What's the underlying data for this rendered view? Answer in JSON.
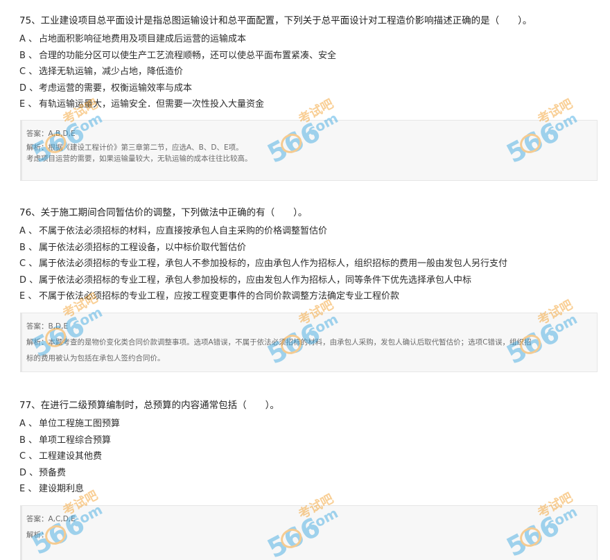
{
  "questions": [
    {
      "stem": "75、工业建设项目总平面设计是指总图运输设计和总平面配置，下列关于总平面设计对工程造价影响描述正确的是（　　）。",
      "options": [
        {
          "letter": "A 、",
          "text": "占地面积影响征地费用及项目建成后运营的运输成本"
        },
        {
          "letter": "B 、",
          "text": "合理的功能分区可以使生产工艺流程顺畅，还可以使总平面布置紧凑、安全"
        },
        {
          "letter": "C 、",
          "text": "选择无轨运输，减少占地，降低造价"
        },
        {
          "letter": "D 、",
          "text": "考虑运营的需要，权衡运输效率与成本"
        },
        {
          "letter": "E 、",
          "text": "有轨运输运量大，运输安全．但需要一次性投入大量资金"
        }
      ],
      "answer": "答案：A,B,D,E",
      "analysis_lines": [
        "解析：根据《建设工程计价》第三章第二节，应选A、B、D、E项。",
        "考虑项目运营的需要，如果运输量较大，无轨运输的成本往往比较高。"
      ]
    },
    {
      "stem": "76、关于施工期间合同暂估价的调整，下列做法中正确的有（　　）。",
      "options": [
        {
          "letter": "A 、",
          "text": "不属于依法必须招标的材料，应直接按承包人自主采购的价格调整暂估价"
        },
        {
          "letter": "B 、",
          "text": "属于依法必须招标的工程设备，以中标价取代暂估价"
        },
        {
          "letter": "C 、",
          "text": "属于依法必须招标的专业工程，承包人不参加投标的，应由承包人作为招标人，组织招标的费用一般由发包人另行支付"
        },
        {
          "letter": "D 、",
          "text": "属于依法必须招标的专业工程，承包人参加投标的，应由发包人作为招标人，同等条件下优先选择承包人中标"
        },
        {
          "letter": "E 、",
          "text": "不属于依法必须招标的专业工程，应按工程变更事件的合同价款调整方法确定专业工程价款"
        }
      ],
      "answer": "答案：B,D,E",
      "analysis_lines": [
        "解析：本题考查的是物价变化类合同价款调整事项。选项A错误，不属于依法必须招标的材料，由承包人采购，发包人确认后取代暂估价；选项C错误，组织招",
        "标的费用被认为包括在承包人签约合同价。"
      ]
    },
    {
      "stem": "77、在进行二级预算编制时，总预算的内容通常包括（　　）。",
      "options": [
        {
          "letter": "A 、",
          "text": "单位工程施工图预算"
        },
        {
          "letter": "B 、",
          "text": "单项工程综合预算"
        },
        {
          "letter": "C 、",
          "text": "工程建设其他费"
        },
        {
          "letter": "D 、",
          "text": "预备费"
        },
        {
          "letter": "E 、",
          "text": "建设期利息"
        }
      ],
      "answer": "答案：A,C,D,E",
      "analysis_lines": [
        "解析："
      ]
    }
  ],
  "watermark": {
    "brand_number": "566",
    "brand_cn": "考试吧",
    "brand_domain": ".com",
    "color_orange": "#f29a1e",
    "color_blue": "#3aa6e0"
  }
}
